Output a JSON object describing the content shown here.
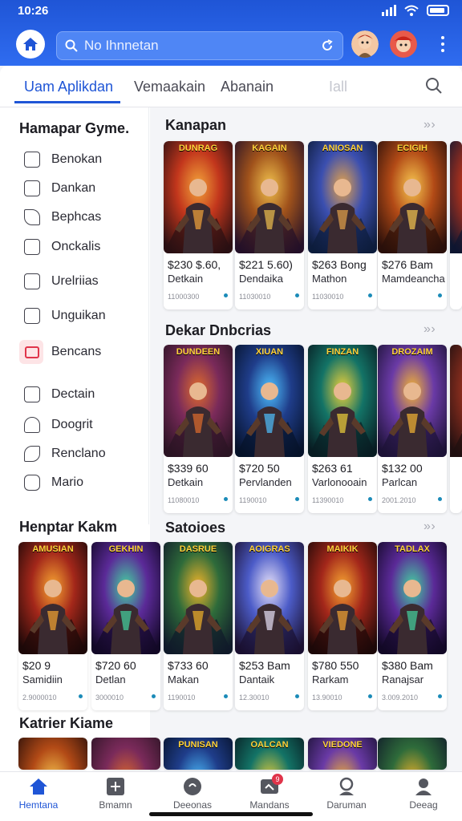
{
  "status": {
    "time": "10:26"
  },
  "search": {
    "placeholder": "No Ihnnetan"
  },
  "tabs": [
    "Uam Aplikdan",
    "Vemaakain",
    "Abanain",
    "Iall"
  ],
  "sidebar": {
    "title": "Hamapar Gyme.",
    "items": [
      "Benokan",
      "Dankan",
      "Bephcas",
      "Onckalis",
      "Urelriias",
      "Unguikan",
      "Bencans",
      "Dectain",
      "Doogrit",
      "Renclano",
      "Mario"
    ]
  },
  "sections": [
    {
      "title": "Kanapan",
      "cards": [
        {
          "cover": "DUNRAG",
          "price": "$230 $.60,",
          "name": "Detkain",
          "meta": "11000300"
        },
        {
          "cover": "KAGAIN",
          "price": "$221 5.60)",
          "name": "Dendaika",
          "meta": "11030010"
        },
        {
          "cover": "ANIOSAN",
          "price": "$263 Bong",
          "name": "Mathon",
          "meta": "11030010"
        },
        {
          "cover": "ECIGIH",
          "price": "$276 Bam",
          "name": "Mamdeancha",
          "meta": ""
        }
      ]
    },
    {
      "title": "Dekar Dnbcrias",
      "cards": [
        {
          "cover": "DUNDEEN",
          "price": "$339 60",
          "name": "Detkain",
          "meta": "11080010"
        },
        {
          "cover": "XIUAN",
          "price": "$720 50",
          "name": "Pervlanden",
          "meta": "1190010"
        },
        {
          "cover": "FINZAN",
          "price": "$263 61",
          "name": "Varlonooain",
          "meta": "11390010"
        },
        {
          "cover": "DROZAIM",
          "price": "$132 00",
          "name": "Parlcan",
          "meta": "2001.2010"
        }
      ]
    },
    {
      "title": "Satoioes",
      "cards": [
        {
          "cover": "DASRUE",
          "price": "$733 60",
          "name": "Makan",
          "meta": "1190010"
        },
        {
          "cover": "AOIGRAS",
          "price": "$253 Bam",
          "name": "Dantaik",
          "meta": "12.30010"
        },
        {
          "cover": "MAIKIK",
          "price": "$780 550",
          "name": "Rarkam",
          "meta": "13.90010"
        },
        {
          "cover": "TADLAX",
          "price": "$380 Bam",
          "name": "Ranajsar",
          "meta": "3.009.2010"
        }
      ]
    }
  ],
  "left_section": {
    "title": "Henptar Kakm",
    "cards": [
      {
        "cover": "AMUSIAN",
        "price": "$20 9",
        "name": "Samidiin",
        "meta": "2.9000010"
      },
      {
        "cover": "GEKHIN",
        "price": "$720 60",
        "name": "Detlan",
        "meta": "3000010"
      }
    ]
  },
  "bottom_section": {
    "title": "Katrier Kiame",
    "covers": [
      "",
      "",
      "PUNISAN",
      "OALCAN",
      "VIEDONE",
      ""
    ]
  },
  "bottom_nav": [
    {
      "label": "Hemtana",
      "icon": "home-icon",
      "badge": ""
    },
    {
      "label": "Bmamn",
      "icon": "plus-box-icon",
      "badge": ""
    },
    {
      "label": "Deeonas",
      "icon": "chat-icon",
      "badge": ""
    },
    {
      "label": "Mandans",
      "icon": "message-icon",
      "badge": "9"
    },
    {
      "label": "Daruman",
      "icon": "person-icon",
      "badge": ""
    },
    {
      "label": "Deeag",
      "icon": "profile-icon",
      "badge": ""
    }
  ],
  "colors": {
    "accent": "#1f55d6",
    "badge": "#e0344a"
  }
}
